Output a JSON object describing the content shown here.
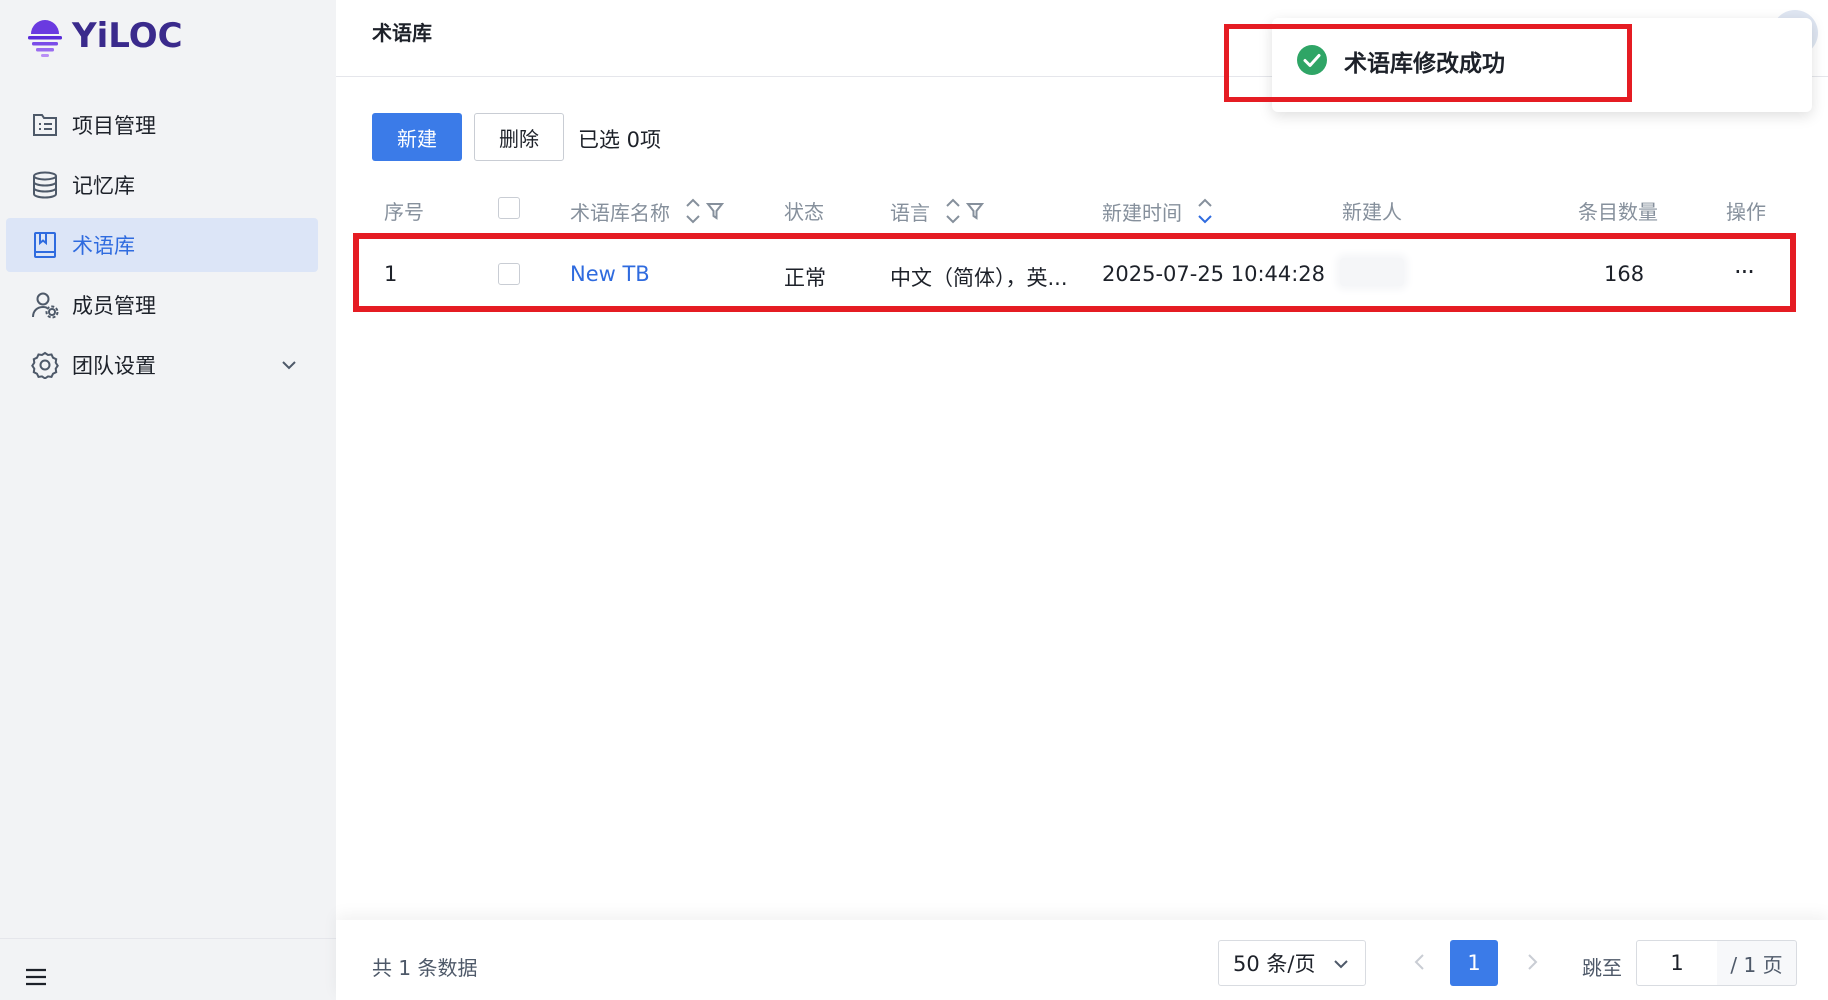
{
  "app": {
    "logo_text": "YiLOC",
    "brand_color": "#5a2bd9"
  },
  "sidebar": {
    "items": [
      {
        "label": "项目管理",
        "icon": "project-list-icon"
      },
      {
        "label": "记忆库",
        "icon": "database-icon"
      },
      {
        "label": "术语库",
        "icon": "book-icon",
        "active": true
      },
      {
        "label": "成员管理",
        "icon": "user-settings-icon"
      },
      {
        "label": "团队设置",
        "icon": "gear-icon",
        "has_submenu": true
      }
    ],
    "collapse_icon": "hamburger-icon"
  },
  "header": {
    "title": "术语库"
  },
  "toast": {
    "message": "术语库修改成功",
    "icon": "check-circle-icon",
    "color": "#2fa566"
  },
  "toolbar": {
    "new_label": "新建",
    "delete_label": "删除",
    "selected_text": "已选 0项"
  },
  "table": {
    "columns": [
      "序号",
      "",
      "术语库名称",
      "状态",
      "语言",
      "新建时间",
      "新建人",
      "条目数量",
      "操作"
    ],
    "rows": [
      {
        "index": "1",
        "name": "New TB",
        "status": "正常",
        "language": "中文（简体），英...",
        "created_at": "2025-07-25 10:44:28",
        "creator": "",
        "entry_count": "168",
        "actions": "···"
      }
    ]
  },
  "pagination": {
    "total_text": "共 1 条数据",
    "page_size": "50 条/页",
    "current_page": "1",
    "jump_label": "跳至",
    "jump_value": "1",
    "total_pages_text": "/ 1 页"
  },
  "colors": {
    "primary": "#3b7be8",
    "highlight_border": "#e51c23",
    "sidebar_bg": "#f2f3f5",
    "active_item_bg": "#dce5f7"
  }
}
